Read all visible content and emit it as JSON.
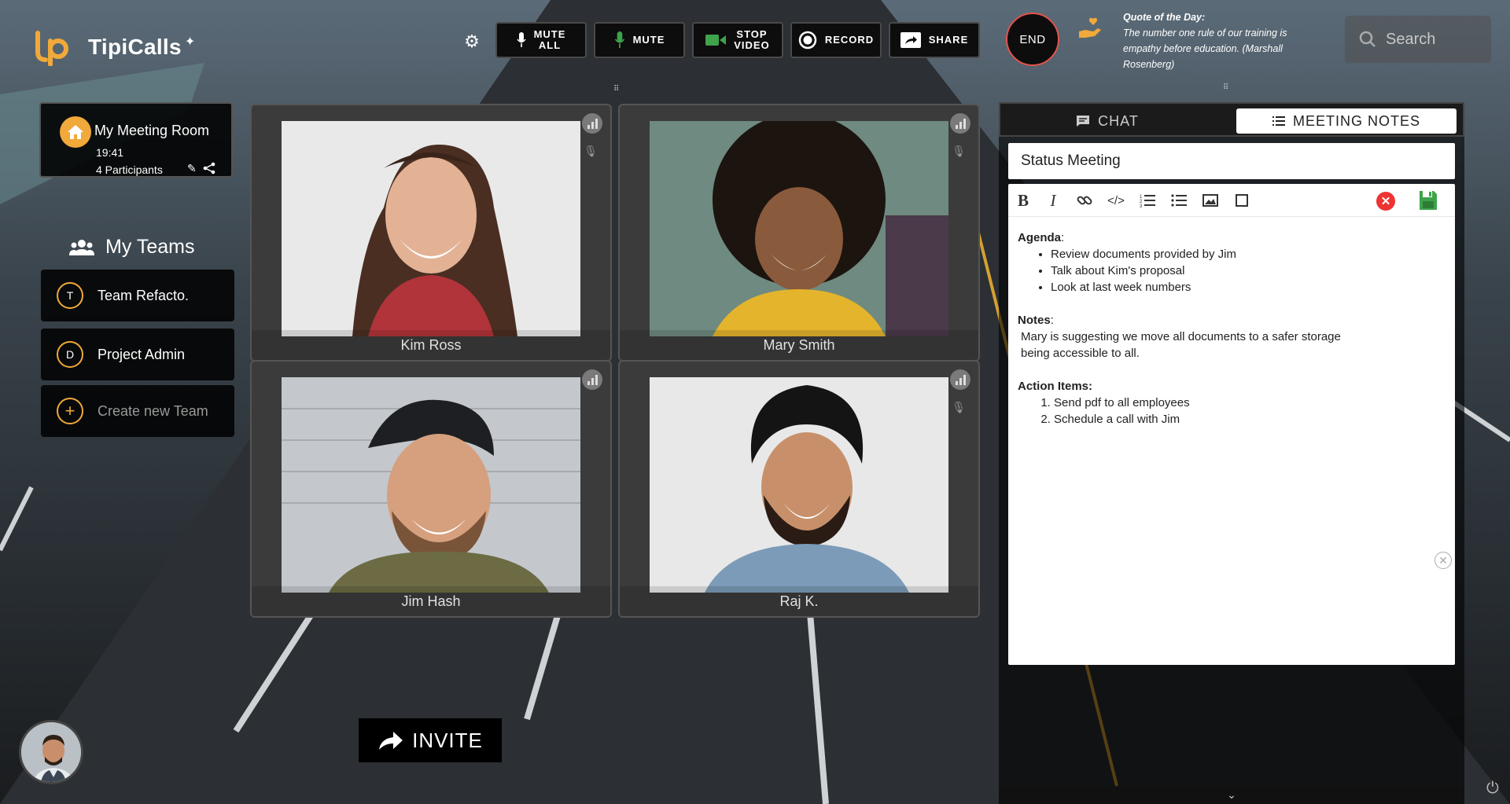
{
  "app": {
    "name": "TipiCalls"
  },
  "toolbar": {
    "settings_icon": "gear-icon",
    "mute_all": "MUTE\nALL",
    "mute": "MUTE",
    "stop_video": "STOP\nVIDEO",
    "record": "RECORD",
    "share": "SHARE",
    "end": "END"
  },
  "quote": {
    "title": "Quote of the Day:",
    "text": "The number one rule of our training is empathy before education. (Marshall Rosenberg)"
  },
  "search": {
    "placeholder": "Search"
  },
  "room": {
    "title": "My Meeting Room",
    "time": "19:41",
    "participants": "4 Participants"
  },
  "teams": {
    "heading": "My Teams",
    "items": [
      {
        "badge": "T",
        "label": "Team Refacto."
      },
      {
        "badge": "D",
        "label": "Project Admin"
      }
    ],
    "create": {
      "badge": "+",
      "label": "Create new Team"
    }
  },
  "invite": {
    "label": "INVITE"
  },
  "participants": [
    {
      "name": "Kim Ross"
    },
    {
      "name": "Mary Smith"
    },
    {
      "name": "Jim Hash"
    },
    {
      "name": "Raj K."
    }
  ],
  "side": {
    "tabs": {
      "chat": "CHAT",
      "notes": "MEETING NOTES"
    },
    "notes_title": "Status Meeting",
    "agenda_label": "Agenda",
    "agenda": [
      "Review documents provided by Jim",
      "Talk about Kim's proposal",
      "Look at last week numbers"
    ],
    "notes_label": "Notes",
    "notes_lines": [
      "Mary is suggesting we move all documents to a safer storage",
      "being accessible to all."
    ],
    "action_label": "Action Items:",
    "actions": [
      "Send pdf to all employees",
      "Schedule a call with Jim"
    ]
  },
  "colors": {
    "accent": "#f0a93a",
    "end_ring": "#e5534b",
    "save_green": "#3ea34a",
    "cancel_red": "#e33333"
  }
}
